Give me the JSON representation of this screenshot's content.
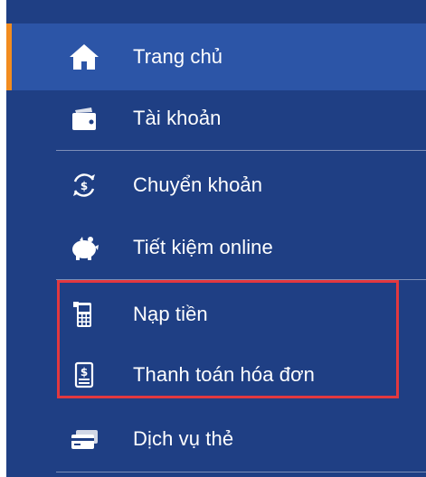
{
  "menu": {
    "items": [
      {
        "id": "trang-chu",
        "label": "Trang chủ",
        "icon": "home-icon",
        "active": true
      },
      {
        "id": "tai-khoan",
        "label": "Tài khoản",
        "icon": "wallet-icon",
        "active": false
      },
      {
        "id": "chuyen-khoan",
        "label": "Chuyển khoản",
        "icon": "transfer-icon",
        "active": false
      },
      {
        "id": "tiet-kiem-online",
        "label": "Tiết kiệm online",
        "icon": "piggy-bank-icon",
        "active": false
      },
      {
        "id": "nap-tien",
        "label": "Nạp tiền",
        "icon": "phone-topup-icon",
        "active": false
      },
      {
        "id": "thanh-toan-hoa-don",
        "label": "Thanh toán hóa đơn",
        "icon": "bill-icon",
        "active": false
      },
      {
        "id": "dich-vu-the",
        "label": "Dịch vụ thẻ",
        "icon": "card-icon",
        "active": false
      }
    ]
  },
  "colors": {
    "sidebar_bg": "#1f3f84",
    "active_bg": "#2c55a7",
    "active_accent": "#f28c1f",
    "highlight_border": "#e2383f",
    "text": "#ffffff"
  }
}
